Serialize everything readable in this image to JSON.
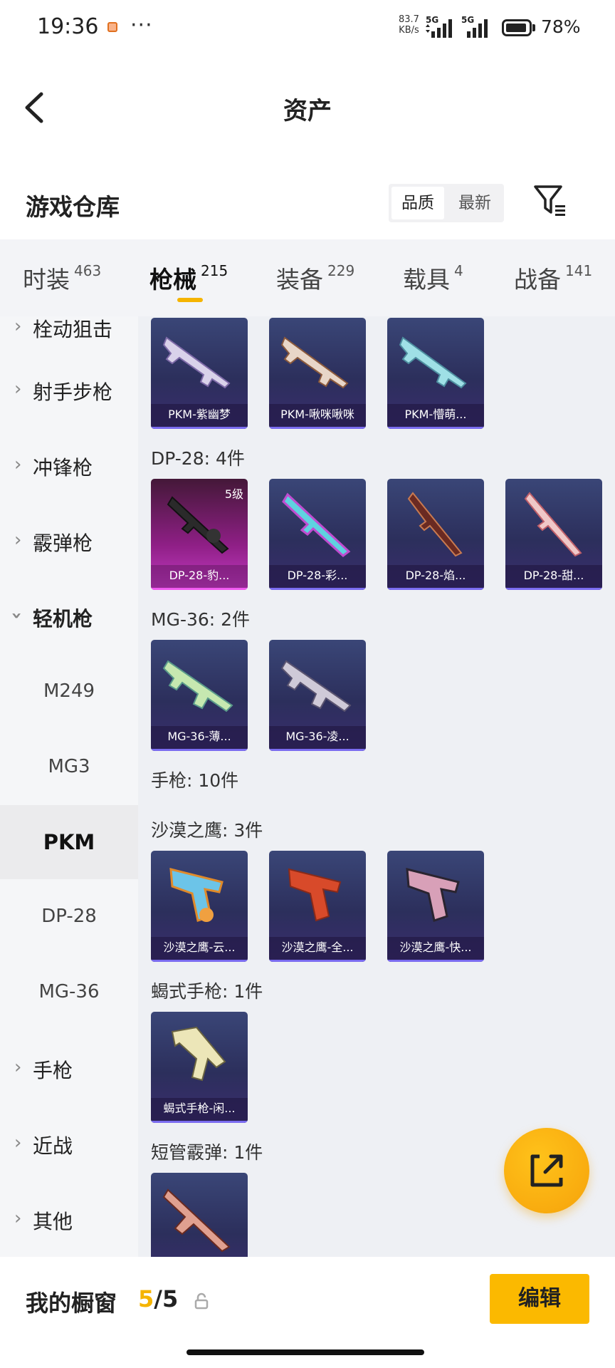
{
  "status_bar": {
    "time": "19:36",
    "net_speed_value": "83.7",
    "net_speed_unit": "KB/s",
    "signal1_label": "5G",
    "signal2_label": "5G",
    "battery": "78%"
  },
  "header": {
    "title": "资产"
  },
  "section": {
    "title": "游戏仓库",
    "sort_options": [
      "品质",
      "最新"
    ],
    "sort_selected": "品质"
  },
  "tabs": [
    {
      "label": "时装",
      "count": "463"
    },
    {
      "label": "枪械",
      "count": "215",
      "active": true
    },
    {
      "label": "装备",
      "count": "229"
    },
    {
      "label": "载具",
      "count": "4"
    },
    {
      "label": "战备",
      "count": "141"
    }
  ],
  "sidebar": {
    "top_partial": "栓动狙击",
    "categories": [
      {
        "label": "射手步枪"
      },
      {
        "label": "冲锋枪"
      },
      {
        "label": "霰弹枪"
      },
      {
        "label": "轻机枪",
        "expanded": true
      }
    ],
    "subitems": [
      "M249",
      "MG3",
      "PKM",
      "DP-28",
      "MG-36"
    ],
    "selected_subitem": "PKM",
    "after": [
      {
        "label": "手枪"
      },
      {
        "label": "近战"
      },
      {
        "label": "其他"
      }
    ]
  },
  "content": {
    "pkm_cards": [
      "PKM-紫幽梦",
      "PKM-啾咪啾咪",
      "PKM-懵萌..."
    ],
    "dp28_title": "DP-28: 4件",
    "dp28_cards": [
      "DP-28-豹...",
      "DP-28-彩...",
      "DP-28-焰...",
      "DP-28-甜..."
    ],
    "dp28_level_badge": "5级",
    "mg36_title": "MG-36: 2件",
    "mg36_cards": [
      "MG-36-薄...",
      "MG-36-凌..."
    ],
    "pistol_title": "手枪: 10件",
    "deagle_title": "沙漠之鹰: 3件",
    "deagle_cards": [
      "沙漠之鹰-云...",
      "沙漠之鹰-全...",
      "沙漠之鹰-快..."
    ],
    "scorpion_title": "蝎式手枪: 1件",
    "scorpion_cards": [
      "蝎式手枪-闲..."
    ],
    "sawedoff_title": "短管霰弹: 1件"
  },
  "bottom_bar": {
    "label": "我的橱窗",
    "count_current": "5",
    "count_total": "/5",
    "edit_label": "编辑"
  },
  "colors": {
    "accent": "#fbb900",
    "card_border": "#7b6cf0",
    "card_pink": "#c43cc4"
  },
  "icons": {
    "back": "chevron-left-icon",
    "filter": "filter-icon",
    "lock": "lock-icon",
    "share": "external-link-icon"
  }
}
